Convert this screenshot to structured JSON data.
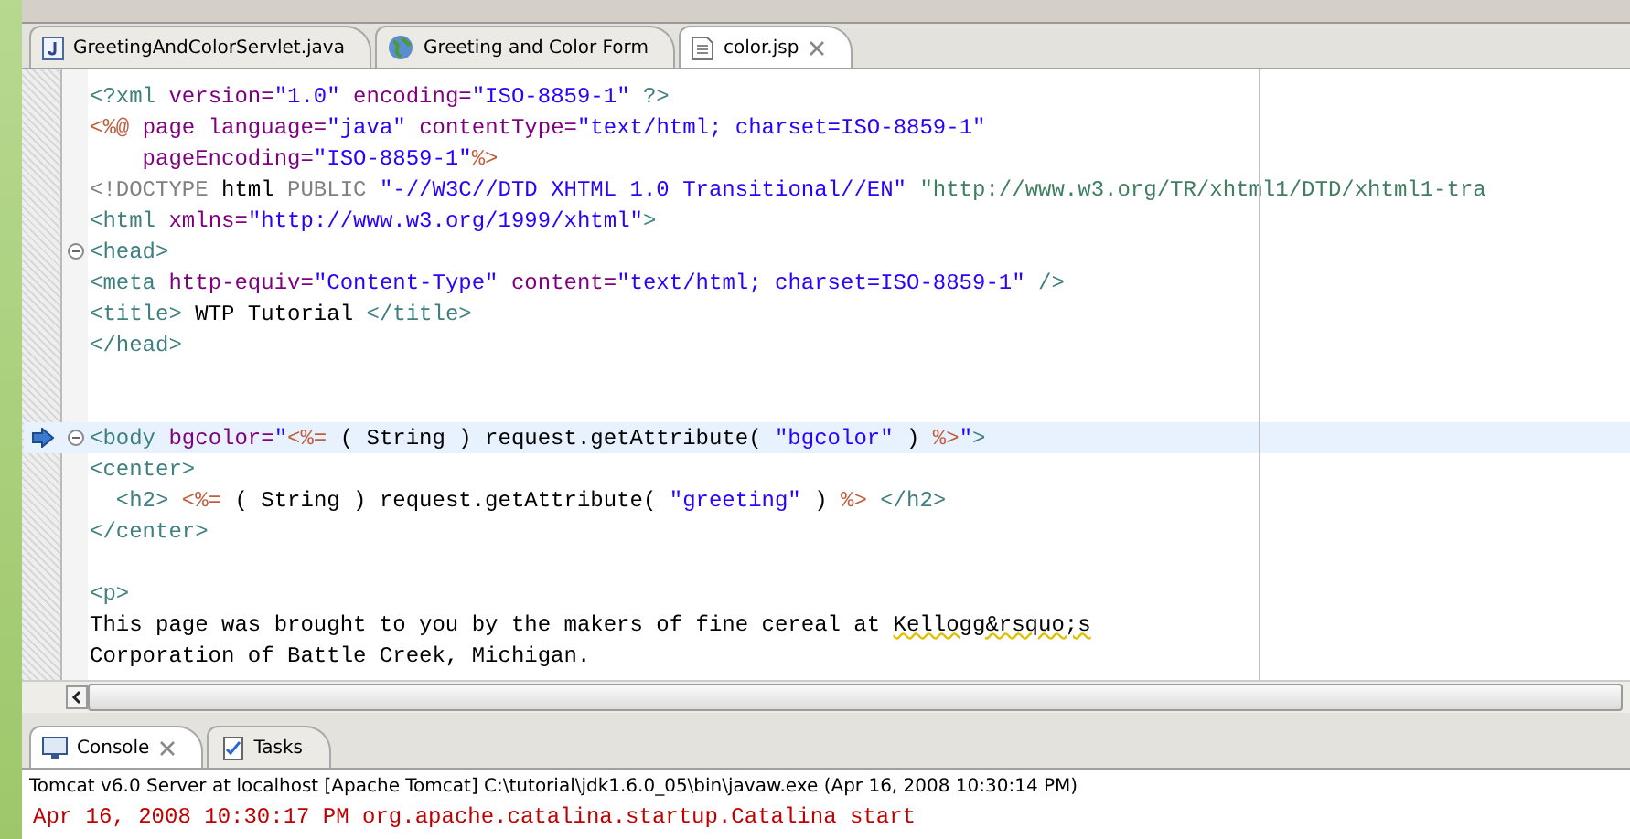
{
  "editor_tabs": [
    {
      "kind": "java",
      "label": "GreetingAndColorServlet.java",
      "selected": false
    },
    {
      "kind": "web",
      "label": "Greeting and Color Form",
      "selected": false
    },
    {
      "kind": "jsp",
      "label": "color.jsp",
      "selected": true
    }
  ],
  "code_lines": [
    {
      "fold": false,
      "current": false,
      "pointer": false,
      "tokens": [
        {
          "kind": "tag",
          "text": "<?xml "
        },
        {
          "kind": "attr",
          "text": "version="
        },
        {
          "kind": "value",
          "text": "\"1.0\" "
        },
        {
          "kind": "attr",
          "text": "encoding="
        },
        {
          "kind": "value",
          "text": "\"ISO-8859-1\""
        },
        {
          "kind": "tag",
          "text": " ?>"
        }
      ]
    },
    {
      "fold": false,
      "current": false,
      "pointer": false,
      "tokens": [
        {
          "kind": "jsp",
          "text": "<%@ "
        },
        {
          "kind": "attr",
          "text": "page language="
        },
        {
          "kind": "value",
          "text": "\"java\" "
        },
        {
          "kind": "attr",
          "text": "contentType="
        },
        {
          "kind": "value",
          "text": "\"text/html; charset=ISO-8859-1\""
        }
      ]
    },
    {
      "fold": false,
      "current": false,
      "pointer": false,
      "tokens": [
        {
          "kind": "attr",
          "text": "    pageEncoding="
        },
        {
          "kind": "value",
          "text": "\"ISO-8859-1\""
        },
        {
          "kind": "jsp",
          "text": "%>"
        }
      ]
    },
    {
      "fold": false,
      "current": false,
      "pointer": false,
      "tokens": [
        {
          "kind": "keyword",
          "text": "<!DOCTYPE "
        },
        {
          "kind": "plain",
          "text": "html "
        },
        {
          "kind": "keyword",
          "text": "PUBLIC "
        },
        {
          "kind": "value",
          "text": "\"-//W3C//DTD XHTML 1.0 Transitional//EN\" "
        },
        {
          "kind": "url",
          "text": "\"http://www.w3.org/TR/xhtml1/DTD/xhtml1-tra"
        }
      ]
    },
    {
      "fold": false,
      "current": false,
      "pointer": false,
      "tokens": [
        {
          "kind": "tag",
          "text": "<html "
        },
        {
          "kind": "attr",
          "text": "xmlns="
        },
        {
          "kind": "value",
          "text": "\"http://www.w3.org/1999/xhtml\""
        },
        {
          "kind": "tag",
          "text": ">"
        }
      ]
    },
    {
      "fold": true,
      "current": false,
      "pointer": false,
      "tokens": [
        {
          "kind": "tag",
          "text": "<head>"
        }
      ]
    },
    {
      "fold": false,
      "current": false,
      "pointer": false,
      "tokens": [
        {
          "kind": "tag",
          "text": "<meta "
        },
        {
          "kind": "attr",
          "text": "http-equiv="
        },
        {
          "kind": "value",
          "text": "\"Content-Type\" "
        },
        {
          "kind": "attr",
          "text": "content="
        },
        {
          "kind": "value",
          "text": "\"text/html; charset=ISO-8859-1\""
        },
        {
          "kind": "tag",
          "text": " />"
        }
      ]
    },
    {
      "fold": false,
      "current": false,
      "pointer": false,
      "tokens": [
        {
          "kind": "tag",
          "text": "<title>"
        },
        {
          "kind": "plain",
          "text": " WTP Tutorial "
        },
        {
          "kind": "tag",
          "text": "</title>"
        }
      ]
    },
    {
      "fold": false,
      "current": false,
      "pointer": false,
      "tokens": [
        {
          "kind": "tag",
          "text": "</head>"
        }
      ]
    },
    {
      "fold": false,
      "current": false,
      "pointer": false
    },
    {
      "fold": false,
      "current": false,
      "pointer": false
    },
    {
      "fold": true,
      "current": true,
      "pointer": true,
      "tokens": [
        {
          "kind": "tag",
          "text": "<body "
        },
        {
          "kind": "attr",
          "text": "bgcolor="
        },
        {
          "kind": "value",
          "text": "\""
        },
        {
          "kind": "jsp",
          "text": "<%="
        },
        {
          "kind": "plain",
          "text": " ( String ) request.getAttribute( "
        },
        {
          "kind": "value",
          "text": "\"bgcolor\""
        },
        {
          "kind": "plain",
          "text": " ) "
        },
        {
          "kind": "jsp",
          "text": "%>"
        },
        {
          "kind": "value",
          "text": "\""
        },
        {
          "kind": "tag",
          "text": ">"
        }
      ]
    },
    {
      "fold": false,
      "current": false,
      "pointer": false,
      "tokens": [
        {
          "kind": "tag",
          "text": "<center>"
        }
      ]
    },
    {
      "fold": false,
      "current": false,
      "pointer": false,
      "tokens": [
        {
          "kind": "tag",
          "text": "  <h2> "
        },
        {
          "kind": "jsp",
          "text": "<%="
        },
        {
          "kind": "plain",
          "text": " ( String ) request.getAttribute( "
        },
        {
          "kind": "value",
          "text": "\"greeting\""
        },
        {
          "kind": "plain",
          "text": " ) "
        },
        {
          "kind": "jsp",
          "text": "%>"
        },
        {
          "kind": "tag",
          "text": " </h2>"
        }
      ]
    },
    {
      "fold": false,
      "current": false,
      "pointer": false,
      "tokens": [
        {
          "kind": "tag",
          "text": "</center>"
        }
      ]
    },
    {
      "fold": false,
      "current": false,
      "pointer": false
    },
    {
      "fold": false,
      "current": false,
      "pointer": false,
      "tokens": [
        {
          "kind": "tag",
          "text": "<p>"
        }
      ]
    },
    {
      "fold": false,
      "current": false,
      "pointer": false,
      "tokens": [
        {
          "kind": "plain",
          "text": "This page was brought to you by the makers of fine cereal at "
        },
        {
          "kind": "warning",
          "text": "Kellogg&rsquo;s"
        }
      ]
    },
    {
      "fold": false,
      "current": false,
      "pointer": false,
      "tokens": [
        {
          "kind": "plain",
          "text": "Corporation of Battle Creek, Michigan."
        }
      ]
    }
  ],
  "console_tabs": [
    {
      "kind": "console",
      "label": "Console",
      "selected": true
    },
    {
      "kind": "tasks",
      "label": "Tasks",
      "selected": false
    }
  ],
  "console": {
    "header": "Tomcat v6.0 Server at localhost [Apache Tomcat] C:\\tutorial\\jdk1.6.0_05\\bin\\javaw.exe (Apr 16, 2008 10:30:14 PM)",
    "output": "Apr 16, 2008 10:30:17 PM org.apache.catalina.startup.Catalina start"
  }
}
